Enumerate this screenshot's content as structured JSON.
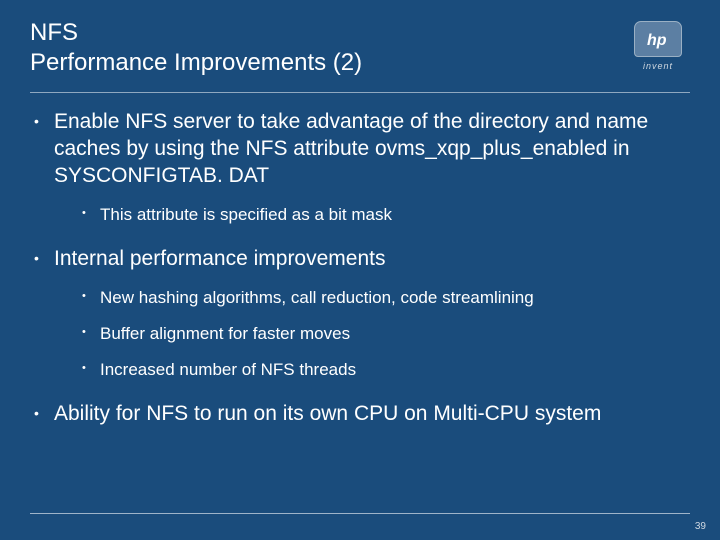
{
  "header": {
    "title_line1": "NFS",
    "title_line2": "Performance Improvements (2)",
    "logo_text": "hp",
    "tagline": "invent"
  },
  "bullets": [
    {
      "text": "Enable NFS server to take advantage of the directory and name caches by using the NFS attribute ovms_xqp_plus_enabled in SYSCONFIGTAB. DAT",
      "sub": [
        "This attribute is specified as a bit mask"
      ]
    },
    {
      "text": "Internal performance improvements",
      "sub": [
        "New hashing algorithms, call reduction, code streamlining",
        "Buffer alignment for faster moves",
        "Increased number of NFS threads"
      ]
    },
    {
      "text": "Ability for NFS to run on its own CPU on Multi-CPU system",
      "sub": []
    }
  ],
  "page_number": "39"
}
